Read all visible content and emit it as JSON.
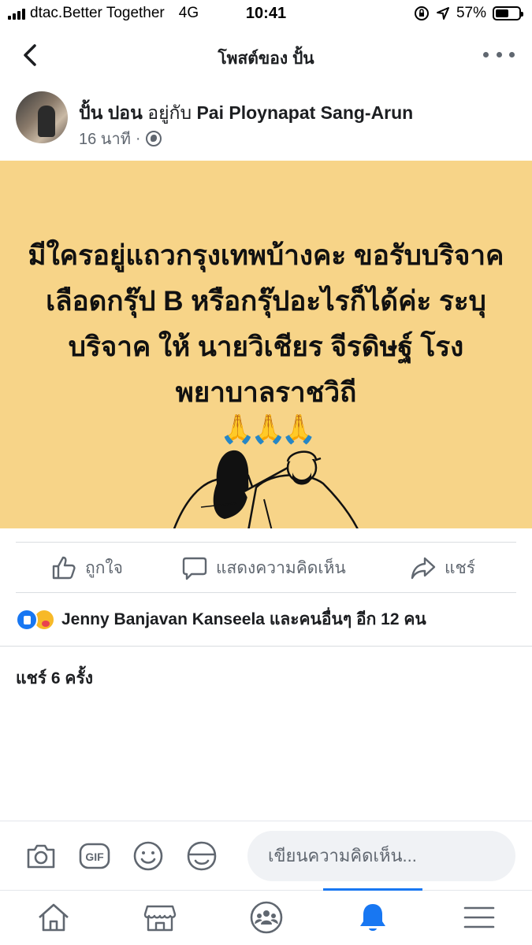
{
  "status": {
    "carrier": "dtac.Better Together",
    "network": "4G",
    "time": "10:41",
    "battery": "57%",
    "battery_level": 0.57
  },
  "nav": {
    "title": "โพสต์ของ ปั้น"
  },
  "post": {
    "author": "ปั้น ปอน",
    "with_text": "อยู่กับ",
    "tagged": "Pai Ploynapat Sang-Arun",
    "time_ago": "16 นาที",
    "dot": "·",
    "background_color": "#f7d488",
    "text": "มีใครอยู่แถวกรุงเทพบ้างคะ ขอรับบริจาคเลือดกรุ๊ป B หรือกรุ๊ปอะไรก็ได้ค่ะ ระบุบริจาค ให้ นายวิเชียร จีรดิษฐ์  โรงพยาบาลราชวิถี",
    "emoji": "🙏🙏🙏"
  },
  "actions": {
    "like": "ถูกใจ",
    "comment": "แสดงความคิดเห็น",
    "share": "แชร์"
  },
  "reactions": {
    "names": "Jenny Banjavan Kanseela",
    "and_others": "และคนอื่นๆ อีก 12 คน"
  },
  "shares": "แชร์ 6 ครั้ง",
  "comment_bar": {
    "placeholder": "เขียนความคิดเห็น..."
  },
  "tabs": [
    "home-icon",
    "marketplace-icon",
    "groups-icon",
    "notifications-icon",
    "menu-icon"
  ],
  "colors": {
    "accent": "#1877f2",
    "icon_gray": "#606770"
  }
}
